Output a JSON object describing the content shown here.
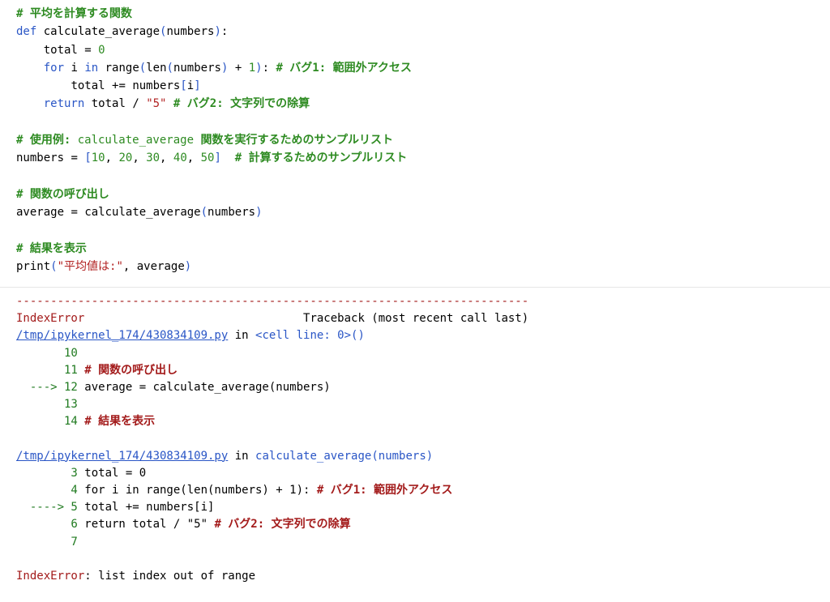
{
  "code": {
    "l1": "# 平均を計算する関数",
    "l2_kw": "def",
    "l2_name": "calculate_average",
    "l2_arg": "numbers",
    "l3_var": "total",
    "l3_num": "0",
    "l4_kw_for": "for",
    "l4_i": "i",
    "l4_kw_in": "in",
    "l4_range": "range",
    "l4_len": "len",
    "l4_arg": "numbers",
    "l4_one": "1",
    "l4_cmt": "# バグ1: 範囲外アクセス",
    "l5_total": "total",
    "l5_numbers": "numbers",
    "l5_i": "i",
    "l6_kw": "return",
    "l6_total": "total",
    "l6_str": "\"5\"",
    "l6_cmt": "# バグ2: 文字列での除算",
    "l8_cmt_pre": "# 使用例: ",
    "l8_cmt_code": "calculate_average",
    "l8_cmt_post": " 関数を実行するためのサンプルリスト",
    "l9_var": "numbers",
    "l9_vals": [
      "10",
      "20",
      "30",
      "40",
      "50"
    ],
    "l9_cmt": "# 計算するためのサンプルリスト",
    "l11_cmt": "# 関数の呼び出し",
    "l12_var": "average",
    "l12_call": "calculate_average",
    "l12_arg": "numbers",
    "l14_cmt": "# 結果を表示",
    "l15_fn": "print",
    "l15_str": "\"平均値は:\"",
    "l15_arg": "average"
  },
  "output": {
    "dashes": "---------------------------------------------------------------------------",
    "err_name": "IndexError",
    "traceback_label": "Traceback (most recent call last)",
    "file1": "/tmp/ipykernel_174/430834109.py",
    "in_word": "in",
    "loc1": "<cell line: 0>",
    "loc1_parens": "()",
    "f1_lines": [
      {
        "arrow": "",
        "num": "10",
        "text": ""
      },
      {
        "arrow": "",
        "num": "11",
        "text": "# 関数の呼び出し"
      },
      {
        "arrow": "--->",
        "num": "12",
        "text": "average = calculate_average(numbers)"
      },
      {
        "arrow": "",
        "num": "13",
        "text": ""
      },
      {
        "arrow": "",
        "num": "14",
        "text": "# 結果を表示"
      }
    ],
    "file2": "/tmp/ipykernel_174/430834109.py",
    "loc2": "calculate_average",
    "loc2_arg": "numbers",
    "f2_lines": [
      {
        "arrow": "",
        "num": "3",
        "text": "total = 0"
      },
      {
        "arrow": "",
        "num": "4",
        "text": "for i in range(len(numbers) + 1): # バグ1: 範囲外アクセス"
      },
      {
        "arrow": "---->",
        "num": "5",
        "text": "total += numbers[i]"
      },
      {
        "arrow": "",
        "num": "6",
        "text": "return total / \"5\" # バグ2: 文字列での除算"
      },
      {
        "arrow": "",
        "num": "7",
        "text": ""
      }
    ],
    "final_err": "IndexError",
    "final_msg": ": list index out of range"
  }
}
